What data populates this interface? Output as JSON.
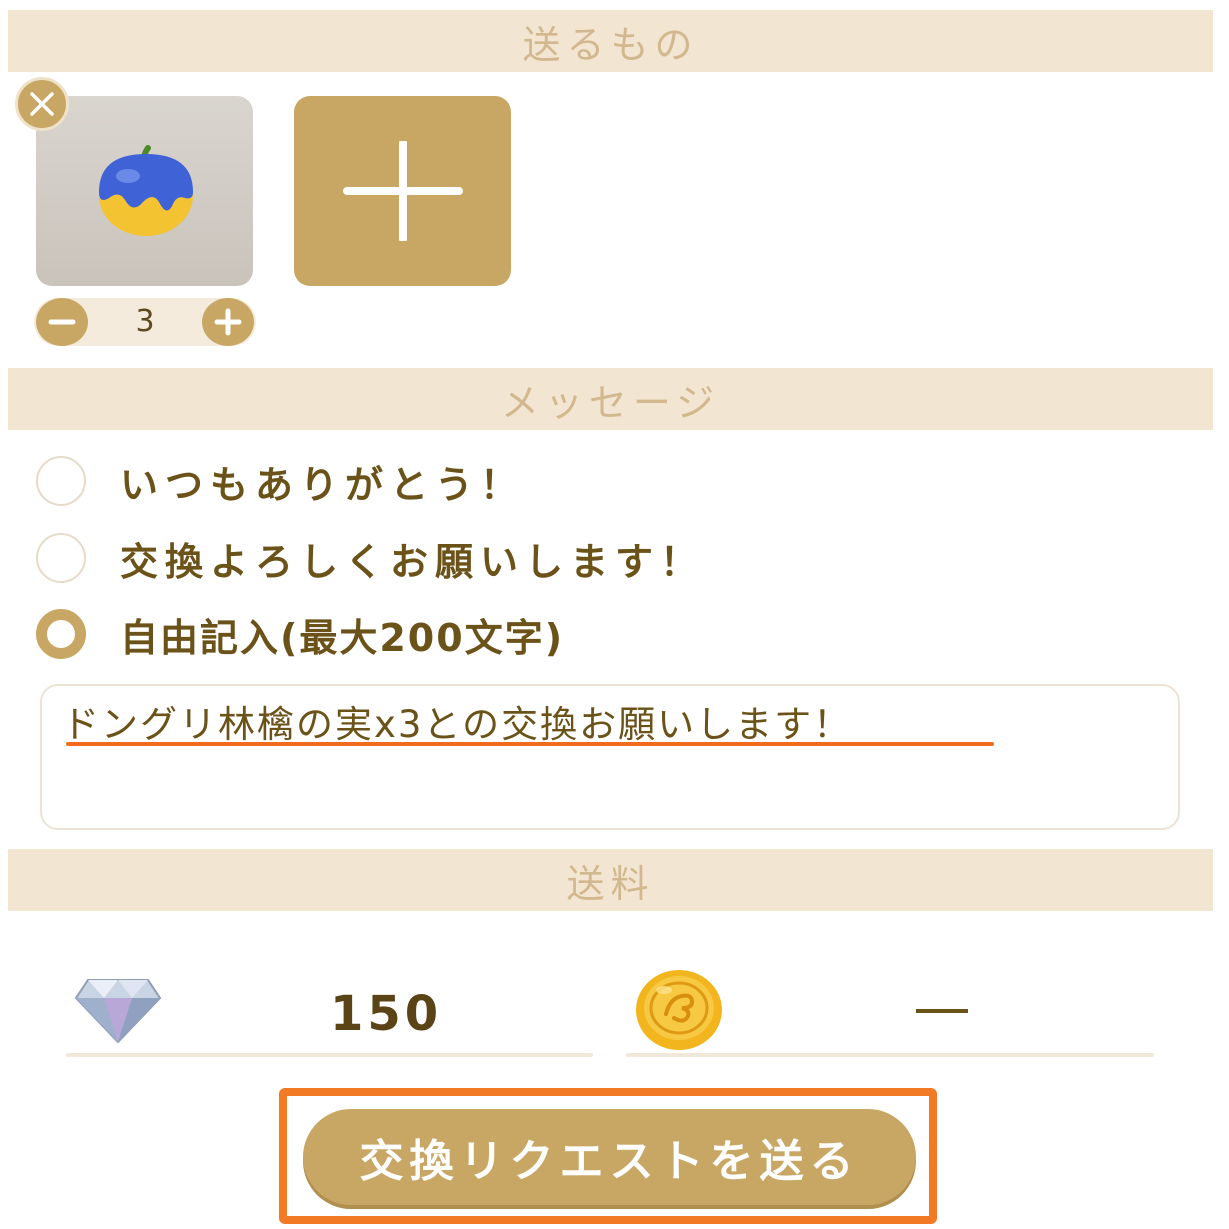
{
  "sections": {
    "send_items": "送るもの",
    "message": "メッセージ",
    "shipping": "送料"
  },
  "items": {
    "selected_item_icon": "blue-apple-icon",
    "quantity": "3",
    "add_icon": "plus-icon",
    "remove_icon": "close-icon"
  },
  "messages": {
    "options": [
      {
        "label": "いつもありがとう！",
        "selected": false
      },
      {
        "label": "交換よろしくお願いします！",
        "selected": false
      },
      {
        "label": "自由記入(最大200文字)",
        "selected": true
      }
    ],
    "free_text": "ドングリ林檎の実x3との交換お願いします！"
  },
  "shipping": {
    "diamond_icon": "diamond-icon",
    "diamond_cost": "150",
    "coin_icon": "coin-icon",
    "coin_cost": "—"
  },
  "submit": {
    "label": "交換リクエストを送る"
  },
  "colors": {
    "gold": "#c8a764",
    "header_bg": "#f2e6d3",
    "header_text": "#d2b88e",
    "text_brown": "#6b5219",
    "highlight_orange": "#f37a25",
    "underline_orange": "#f26b1d"
  }
}
